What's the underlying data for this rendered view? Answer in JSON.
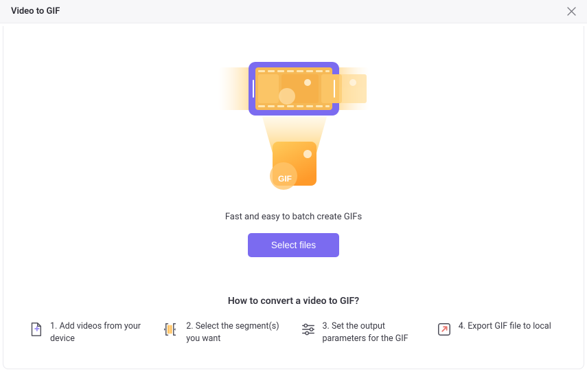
{
  "window": {
    "title": "Video to GIF",
    "closeIcon": "close-icon"
  },
  "hero": {
    "tagline": "Fast and easy to batch create GIFs",
    "selectButton": "Select files",
    "gifBadge": "GIF"
  },
  "howto": {
    "title": "How to convert a video to GIF?",
    "steps": [
      {
        "num": "1.",
        "text": "Add videos from your device"
      },
      {
        "num": "2.",
        "text": "Select the segment(s) you want"
      },
      {
        "num": "3.",
        "text": "Set the output parameters for the GIF"
      },
      {
        "num": "4.",
        "text": "Export GIF file to local"
      }
    ]
  }
}
